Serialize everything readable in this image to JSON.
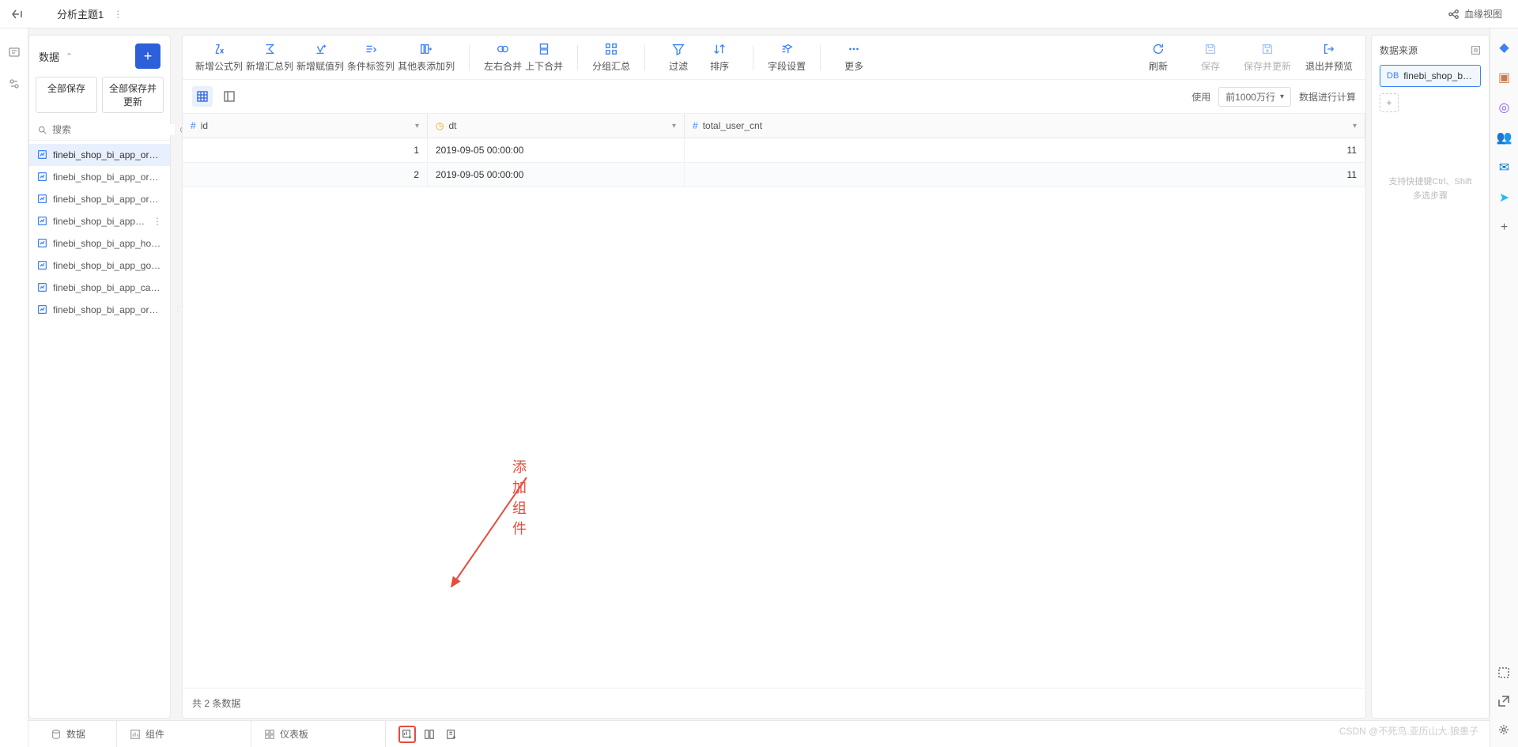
{
  "header": {
    "title": "分析主题1",
    "lineage_label": "血缘视图"
  },
  "data_panel": {
    "title": "数据",
    "save_all": "全部保存",
    "save_all_update": "全部保存并更新",
    "search_placeholder": "搜索",
    "datasets": [
      {
        "label": "finebi_shop_bi_app_ord...",
        "active": true
      },
      {
        "label": "finebi_shop_bi_app_order..."
      },
      {
        "label": "finebi_shop_bi_app_order..."
      },
      {
        "label": "finebi_shop_bi_app_h...",
        "more": true
      },
      {
        "label": "finebi_shop_bi_app_hour_..."
      },
      {
        "label": "finebi_shop_bi_app_goods..."
      },
      {
        "label": "finebi_shop_bi_app_cat_cnt"
      },
      {
        "label": "finebi_shop_bi_app_order..."
      }
    ]
  },
  "toolbar": {
    "items": [
      {
        "label": "新增公式列",
        "icon": "fx"
      },
      {
        "label": "新增汇总列",
        "icon": "sigma"
      },
      {
        "label": "新增赋值列",
        "icon": "assign"
      },
      {
        "label": "条件标签列",
        "icon": "tag"
      },
      {
        "label": "其他表添加列",
        "icon": "addcol"
      }
    ],
    "items2": [
      {
        "label": "左右合并",
        "icon": "merge-h"
      },
      {
        "label": "上下合并",
        "icon": "merge-v"
      }
    ],
    "items3": [
      {
        "label": "分组汇总",
        "icon": "group"
      }
    ],
    "items4": [
      {
        "label": "过滤",
        "icon": "filter"
      },
      {
        "label": "排序",
        "icon": "sort"
      }
    ],
    "items5": [
      {
        "label": "字段设置",
        "icon": "field"
      }
    ],
    "items6": [
      {
        "label": "更多",
        "icon": "more"
      }
    ],
    "right": [
      {
        "label": "刷新",
        "icon": "refresh"
      },
      {
        "label": "保存",
        "icon": "save",
        "disabled": true
      },
      {
        "label": "保存并更新",
        "icon": "save-update",
        "disabled": true
      },
      {
        "label": "退出并预览",
        "icon": "exit"
      }
    ]
  },
  "view": {
    "use_label": "使用",
    "row_limit": "前1000万行",
    "calc_label": "数据进行计算"
  },
  "table": {
    "columns": [
      {
        "name": "id",
        "type": "num"
      },
      {
        "name": "dt",
        "type": "date"
      },
      {
        "name": "total_user_cnt",
        "type": "num"
      }
    ],
    "rows": [
      {
        "id": "1",
        "dt": "2019-09-05 00:00:00",
        "cnt": "11"
      },
      {
        "id": "2",
        "dt": "2019-09-05 00:00:00",
        "cnt": "11"
      }
    ],
    "footer_prefix": "共",
    "footer_count": "2",
    "footer_suffix": "条数据"
  },
  "source": {
    "title": "数据来源",
    "item": "finebi_shop_bi_app...",
    "hint1": "支持快捷键Ctrl、Shift",
    "hint2": "多选步骤"
  },
  "bottom_tabs": {
    "data": "数据",
    "component": "组件",
    "dashboard": "仪表板"
  },
  "annotation": {
    "text": "添加组件"
  },
  "watermark": "CSDN @不死鸟.亚历山大.狼患子"
}
